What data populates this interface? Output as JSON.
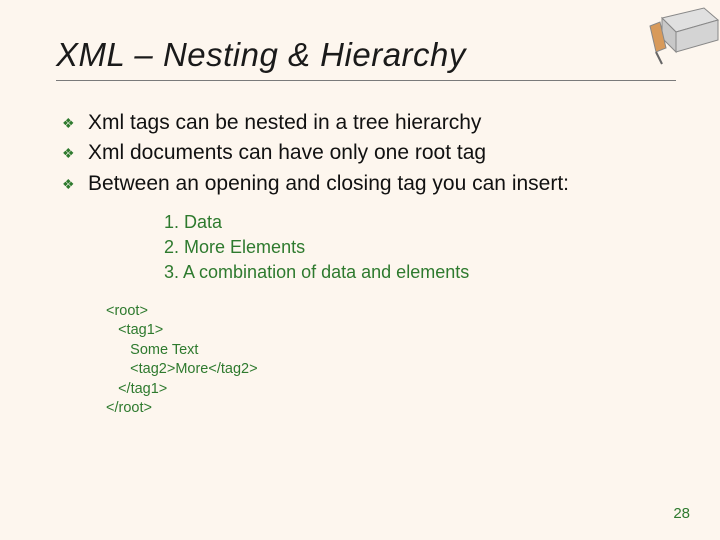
{
  "title": "XML – Nesting & Hierarchy",
  "bullets": [
    "Xml tags can be nested in a tree hierarchy",
    "Xml documents can have only one root tag",
    "Between an opening and closing tag you can insert:"
  ],
  "sublist": [
    "Data",
    "More Elements",
    "A combination of data and elements"
  ],
  "code_lines": {
    "l0": "<root>",
    "l1": "   <tag1>",
    "l2": "      Some Text",
    "l3": "      <tag2>More</tag2>",
    "l4": "   </tag1>",
    "l5": "</root>"
  },
  "page_number": "28",
  "colors": {
    "background": "#fdf6ee",
    "accent_green": "#2e7a2e"
  }
}
